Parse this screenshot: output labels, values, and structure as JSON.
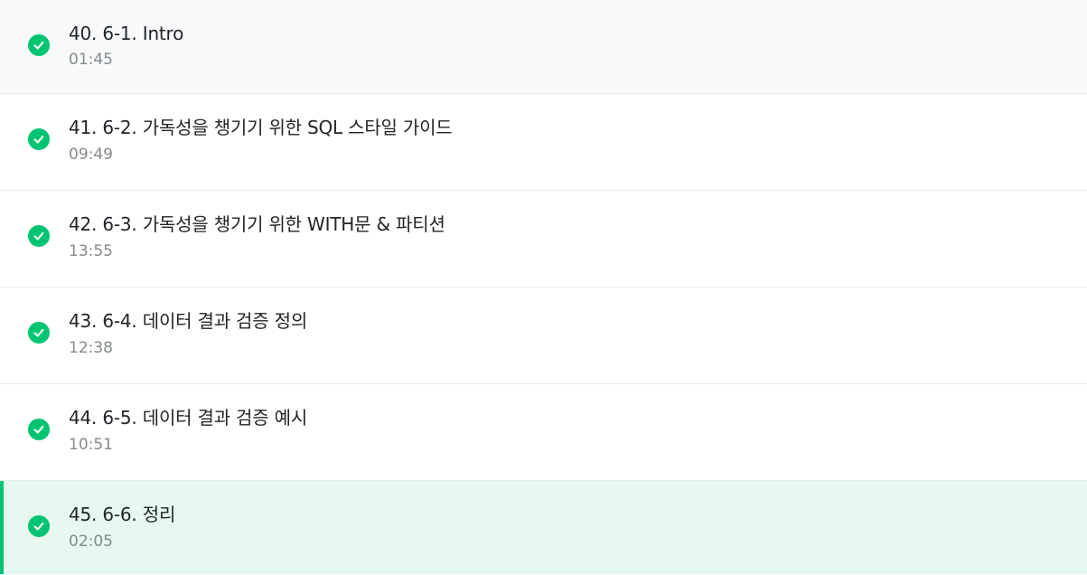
{
  "lessons": [
    {
      "title": "40. 6-1. Intro",
      "duration": "01:45",
      "completed": true,
      "current": false
    },
    {
      "title": "41. 6-2. 가독성을 챙기기 위한 SQL 스타일 가이드",
      "duration": "09:49",
      "completed": true,
      "current": false
    },
    {
      "title": "42. 6-3. 가독성을 챙기기 위한 WITH문 & 파티션",
      "duration": "13:55",
      "completed": true,
      "current": false
    },
    {
      "title": "43. 6-4. 데이터 결과 검증 정의",
      "duration": "12:38",
      "completed": true,
      "current": false
    },
    {
      "title": "44. 6-5. 데이터 결과 검증 예시",
      "duration": "10:51",
      "completed": true,
      "current": false
    },
    {
      "title": "45. 6-6. 정리",
      "duration": "02:05",
      "completed": true,
      "current": true
    }
  ],
  "colors": {
    "accent": "#00c471",
    "current_bg": "#e6f8ef",
    "first_row_bg": "#f8f9fa",
    "title_text": "#212529",
    "duration_text": "#858a8d"
  },
  "icons": {
    "completed": "check-circle-icon"
  }
}
